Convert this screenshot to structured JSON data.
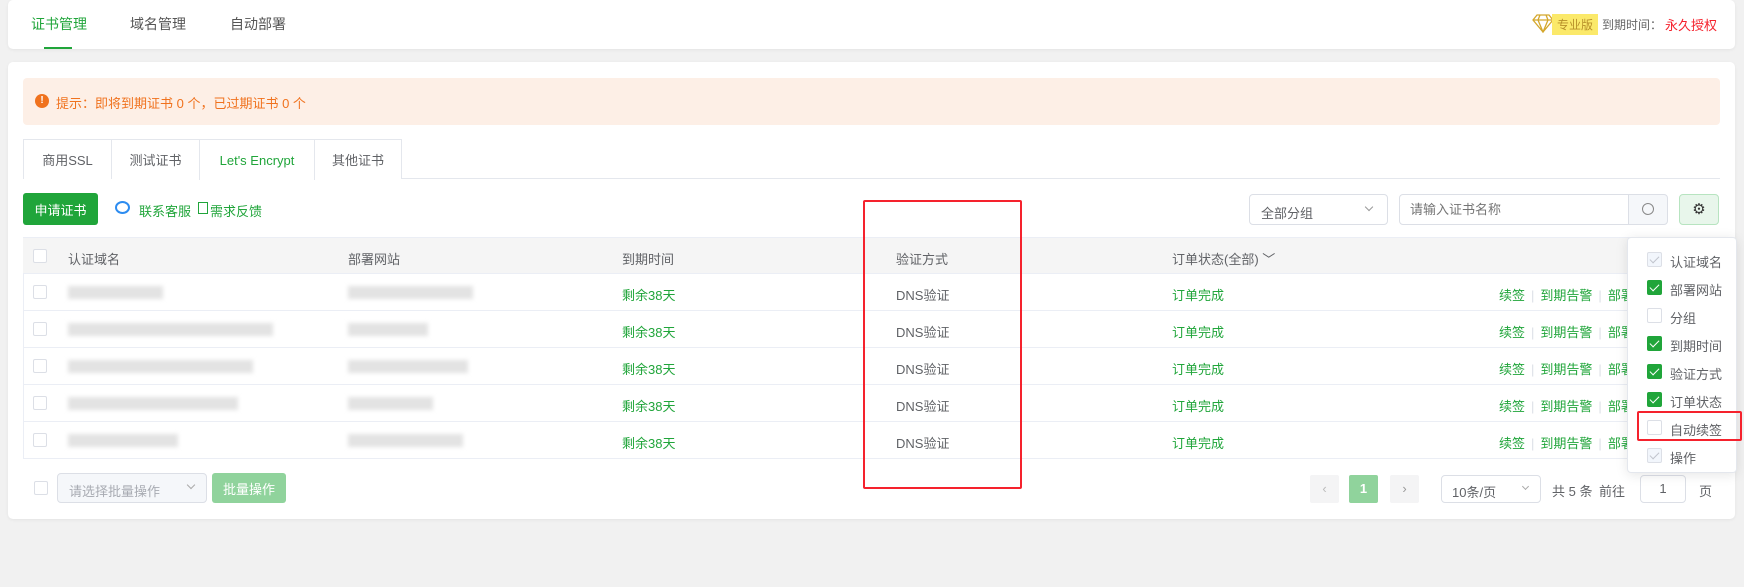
{
  "header": {
    "nav": [
      "证书管理",
      "域名管理",
      "自动部署"
    ],
    "active": 0,
    "edition_badge": "专业版",
    "expire_label": "到期时间：",
    "expire_value": "永久授权"
  },
  "alert": {
    "text": "提示：即将到期证书 0 个，已过期证书 0 个"
  },
  "cert_tabs": [
    "商用SSL",
    "测试证书",
    "Let's Encrypt",
    "其他证书"
  ],
  "active_tab": 2,
  "toolbar": {
    "apply_button": "申请证书",
    "contact": "联系客服",
    "feedback": "需求反馈",
    "group_select": "全部分组",
    "search_placeholder": "请输入证书名称"
  },
  "table": {
    "headers": [
      "认证域名",
      "部署网站",
      "到期时间",
      "验证方式",
      "订单状态(全部)"
    ],
    "rows": [
      {
        "expiry": "剩余38天",
        "verify": "DNS验证",
        "status": "订单完成"
      },
      {
        "expiry": "剩余38天",
        "verify": "DNS验证",
        "status": "订单完成"
      },
      {
        "expiry": "剩余38天",
        "verify": "DNS验证",
        "status": "订单完成"
      },
      {
        "expiry": "剩余38天",
        "verify": "DNS验证",
        "status": "订单完成"
      },
      {
        "expiry": "剩余38天",
        "verify": "DNS验证",
        "status": "订单完成"
      }
    ],
    "actions": [
      "续签",
      "到期告警",
      "部署"
    ]
  },
  "column_settings": [
    {
      "label": "认证域名",
      "checked": true,
      "disabled": true
    },
    {
      "label": "部署网站",
      "checked": true
    },
    {
      "label": "分组",
      "checked": false
    },
    {
      "label": "到期时间",
      "checked": true
    },
    {
      "label": "验证方式",
      "checked": true
    },
    {
      "label": "订单状态",
      "checked": true
    },
    {
      "label": "自动续签",
      "checked": false
    },
    {
      "label": "操作",
      "checked": true,
      "disabled": true
    }
  ],
  "footer": {
    "batch_placeholder": "请选择批量操作",
    "batch_button": "批量操作",
    "page": "1",
    "page_size": "10条/页",
    "total": "共 5 条",
    "goto": "前往",
    "goto_value": "1",
    "page_unit": "页"
  },
  "colors": {
    "accent": "#20a53a",
    "highlight": "#f5222d",
    "warning": "#f0721e"
  }
}
